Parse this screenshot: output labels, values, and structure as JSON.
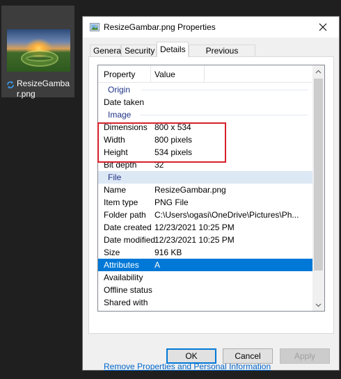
{
  "desktop": {
    "file_label": "ResizeGambar.png"
  },
  "dialog": {
    "title": "ResizeGambar.png Properties",
    "tabs": [
      {
        "label": "General"
      },
      {
        "label": "Security"
      },
      {
        "label": "Details"
      },
      {
        "label": "Previous Versions"
      }
    ],
    "active_tab": "Details",
    "columns": {
      "property": "Property",
      "value": "Value"
    },
    "groups": {
      "origin": "Origin",
      "image": "Image",
      "file": "File"
    },
    "origin_rows": [
      {
        "key": "Date taken",
        "value": ""
      }
    ],
    "image_rows": [
      {
        "key": "Dimensions",
        "value": "800 x 534"
      },
      {
        "key": "Width",
        "value": "800 pixels"
      },
      {
        "key": "Height",
        "value": "534 pixels"
      },
      {
        "key": "Bit depth",
        "value": "32"
      }
    ],
    "file_rows": [
      {
        "key": "Name",
        "value": "ResizeGambar.png"
      },
      {
        "key": "Item type",
        "value": "PNG File"
      },
      {
        "key": "Folder path",
        "value": "C:\\Users\\ogasi\\OneDrive\\Pictures\\Ph..."
      },
      {
        "key": "Date created",
        "value": "12/23/2021 10:25 PM"
      },
      {
        "key": "Date modified",
        "value": "12/23/2021 10:25 PM"
      },
      {
        "key": "Size",
        "value": "916 KB"
      },
      {
        "key": "Attributes",
        "value": "A"
      },
      {
        "key": "Availability",
        "value": ""
      },
      {
        "key": "Offline status",
        "value": ""
      },
      {
        "key": "Shared with",
        "value": ""
      }
    ],
    "selected_row": "Attributes",
    "remove_link": "Remove Properties and Personal Information",
    "buttons": {
      "ok": "OK",
      "cancel": "Cancel",
      "apply": "Apply"
    },
    "colors": {
      "selection": "#0078d7",
      "highlight_border": "#d6202a",
      "group_text": "#1e3287"
    }
  }
}
